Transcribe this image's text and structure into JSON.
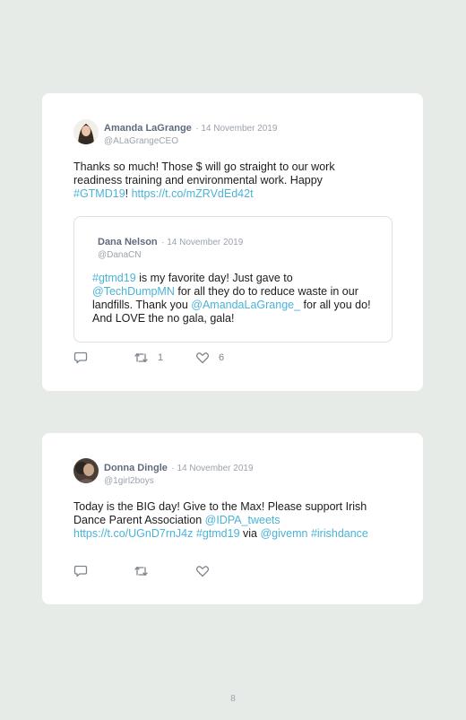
{
  "tweets": [
    {
      "name": "Amanda LaGrange",
      "date": "· 14 November 2019",
      "handle": "@ALaGrangeCEO",
      "text_1": "Thanks so much! Those $ will go straight to our work readiness training and environmental work. Happy ",
      "hashtag_1": "#GTMD19",
      "text_2": "! ",
      "link_1": "https://t.co/mZRVdEd42t",
      "quoted": {
        "name": "Dana Nelson",
        "date": "· 14 November 2019",
        "handle": "@DanaCN",
        "hashtag_1": "#gtmd19",
        "text_1": " is my favorite day! Just gave to ",
        "mention_1": "@TechDumpMN",
        "text_2": " for all they do to reduce waste in our landfills. Thank you ",
        "mention_2": "@AmandaLaGrange_",
        "text_3": " for all you do! And LOVE the no gala, gala!"
      },
      "retweets": "1",
      "likes": "6"
    },
    {
      "name": "Donna Dingle",
      "date": "· 14 November 2019",
      "handle": "@1girl2boys",
      "text_1": "Today is the BIG day! Give to the Max! Please support Irish Dance Parent Association ",
      "mention_1": "@IDPA_tweets",
      "link_1": "https://t.co/UGnD7rnJ4z",
      "hashtag_1": "#gtmd19",
      "text_2": " via ",
      "mention_2": "@givemn",
      "hashtag_2": "#irishdance"
    }
  ],
  "page_number": "8",
  "colors": {
    "link": "#4ab3d8",
    "name": "#5f6b7d",
    "muted": "#9aa2ad",
    "background": "#e6ebe8"
  }
}
